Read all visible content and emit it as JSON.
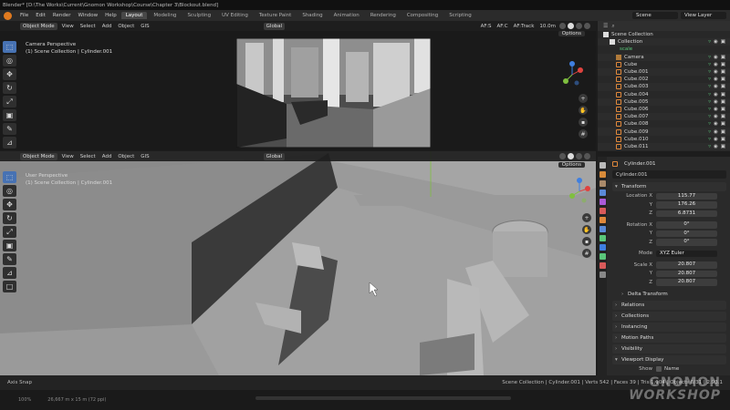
{
  "window": {
    "title": "Blender* [D:\\The Works\\Current\\Gnomon Workshop\\Course\\Chapter 3\\Blockout.blend]"
  },
  "topbar": {
    "menus": [
      "File",
      "Edit",
      "Render",
      "Window",
      "Help"
    ],
    "workspaces": [
      "Layout",
      "Modeling",
      "Sculpting",
      "UV Editing",
      "Texture Paint",
      "Shading",
      "Animation",
      "Rendering",
      "Compositing",
      "Scripting"
    ],
    "active_workspace": "Layout",
    "scene_name": "Scene",
    "view_layer": "View Layer"
  },
  "camera_view": {
    "mode": "Object Mode",
    "menus": [
      "View",
      "Select",
      "Add",
      "Object",
      "GIS"
    ],
    "orientation": "Global",
    "overlay_title": "Camera Perspective",
    "overlay_sub": "(1) Scene Collection | Cylinder.001",
    "options": "Options",
    "af_labels": [
      "AF:S",
      "AF:C",
      "AF:Track"
    ],
    "focal": "10.0m"
  },
  "user_view": {
    "mode": "Object Mode",
    "menus": [
      "View",
      "Select",
      "Add",
      "Object",
      "GIS"
    ],
    "orientation": "Global",
    "overlay_title": "User Perspective",
    "overlay_sub": "(1) Scene Collection | Cylinder.001",
    "options": "Options"
  },
  "outliner": {
    "root": "Scene Collection",
    "items": [
      {
        "label": "Collection",
        "type": "collection",
        "indent": 1
      },
      {
        "label": "scale",
        "type": "filter",
        "indent": 2
      },
      {
        "label": "Camera",
        "type": "camera",
        "indent": 2
      },
      {
        "label": "Cube",
        "type": "object",
        "indent": 2
      },
      {
        "label": "Cube.001",
        "type": "object",
        "indent": 2
      },
      {
        "label": "Cube.002",
        "type": "object",
        "indent": 2
      },
      {
        "label": "Cube.003",
        "type": "object",
        "indent": 2
      },
      {
        "label": "Cube.004",
        "type": "object",
        "indent": 2
      },
      {
        "label": "Cube.005",
        "type": "object",
        "indent": 2
      },
      {
        "label": "Cube.006",
        "type": "object",
        "indent": 2
      },
      {
        "label": "Cube.007",
        "type": "object",
        "indent": 2
      },
      {
        "label": "Cube.008",
        "type": "object",
        "indent": 2
      },
      {
        "label": "Cube.009",
        "type": "object",
        "indent": 2
      },
      {
        "label": "Cube.010",
        "type": "object",
        "indent": 2
      },
      {
        "label": "Cube.011",
        "type": "object",
        "indent": 2
      }
    ]
  },
  "properties": {
    "object_label": "Cylinder.001",
    "object_name": "Cylinder.001",
    "transform_label": "Transform",
    "location_label": "Location X",
    "location": [
      "115.77",
      "176.26",
      "6.8731"
    ],
    "rotation_label": "Rotation X",
    "rotation": [
      "0°",
      "0°",
      "0°"
    ],
    "mode_label": "Mode",
    "mode_value": "XYZ Euler",
    "scale_label": "Scale X",
    "scale": [
      "20.807",
      "20.807",
      "20.807"
    ],
    "axis_y": "Y",
    "axis_z": "Z",
    "delta_label": "Delta Transform",
    "panels": [
      "Relations",
      "Collections",
      "Instancing",
      "Motion Paths",
      "Visibility",
      "Viewport Display"
    ],
    "show_label": "Show",
    "name_label": "Name"
  },
  "status": {
    "left": "Axis Snap",
    "right": "Scene Collection | Cylinder.001 | Verts 542 | Faces 39 | Tris 1,104 | Objects 0/31 | 2.93.1"
  },
  "bottom": {
    "zoom": "100%",
    "size": "26,667 m x 15 m (72 ppi)"
  },
  "watermark": {
    "line1": "GNOMON",
    "line2": "WORKSHOP"
  },
  "colors": {
    "accent": "#4772b3",
    "x_axis": "#e0433f",
    "y_axis": "#7fbf3f",
    "z_axis": "#3f7fe0",
    "object_orange": "#e0883b",
    "filter_green": "#5ac67a"
  }
}
